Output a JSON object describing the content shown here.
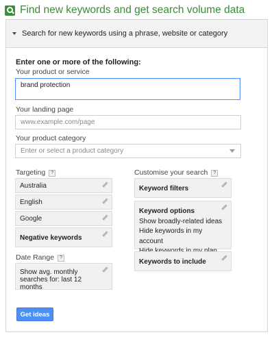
{
  "header": {
    "title": "Find new keywords and get search volume data",
    "icon": "search-icon"
  },
  "section": {
    "title": "Search for new keywords using a phrase, website or category"
  },
  "form": {
    "intro": "Enter one or more of the following:",
    "product_label": "Your product or service",
    "product_value": "brand protection",
    "landing_label": "Your landing page",
    "landing_placeholder": "www.example.com/page",
    "category_label": "Your product category",
    "category_placeholder": "Enter or select a product category"
  },
  "targeting": {
    "label": "Targeting",
    "help": "?",
    "items": [
      "Australia",
      "English",
      "Google",
      "Negative keywords"
    ]
  },
  "date_range": {
    "label": "Date Range",
    "help": "?",
    "value": "Show avg. monthly searches for: last 12 months"
  },
  "customise": {
    "label": "Customise your search",
    "help": "?",
    "keyword_filters": "Keyword filters",
    "keyword_options": {
      "title": "Keyword options",
      "lines": [
        "Show broadly-related ideas",
        "Hide keywords in my account",
        "Hide keywords in my plan"
      ]
    },
    "keywords_to_include": "Keywords to include"
  },
  "actions": {
    "get_ideas": "Get ideas"
  },
  "colors": {
    "accent_green": "#3a8a3a",
    "button_blue": "#4d8ff5",
    "focus_blue": "#4d90fe"
  }
}
